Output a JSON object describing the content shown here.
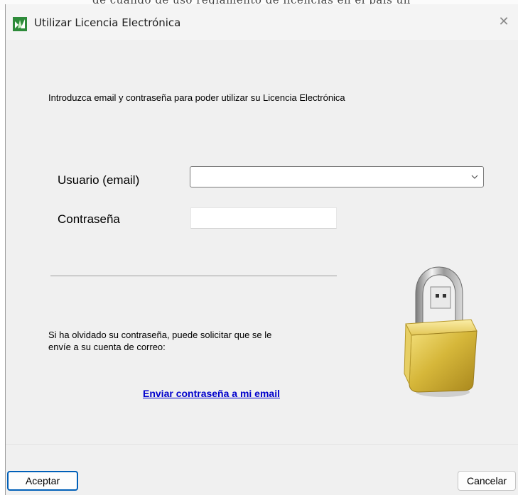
{
  "window": {
    "title": "Utilizar Licencia Electrónica",
    "close_glyph": "✕"
  },
  "background_text": "de cuando de uso reglamento de licencias en el país un",
  "main": {
    "instruction": "Introduzca email y contraseña para poder utilizar su Licencia Electrónica",
    "user_label": "Usuario (email)",
    "user_value": "",
    "password_label": "Contraseña",
    "password_value": "",
    "forgot_line1": "Si ha olvidado su contraseña, puede solicitar que se le",
    "forgot_line2": "envíe a su cuenta de correo:",
    "send_link": "Enviar contraseña a mi email"
  },
  "buttons": {
    "ok": "Aceptar",
    "cancel": "Cancelar"
  },
  "icons": {
    "app": "license-app-icon",
    "close": "close-icon",
    "dropdown": "chevron-down-icon",
    "lock": "usb-padlock-icon"
  },
  "colors": {
    "link": "#0000cc",
    "accent": "#005fb8",
    "window_bg": "#f0f0f0",
    "lock_gold": "#d6b73a"
  }
}
